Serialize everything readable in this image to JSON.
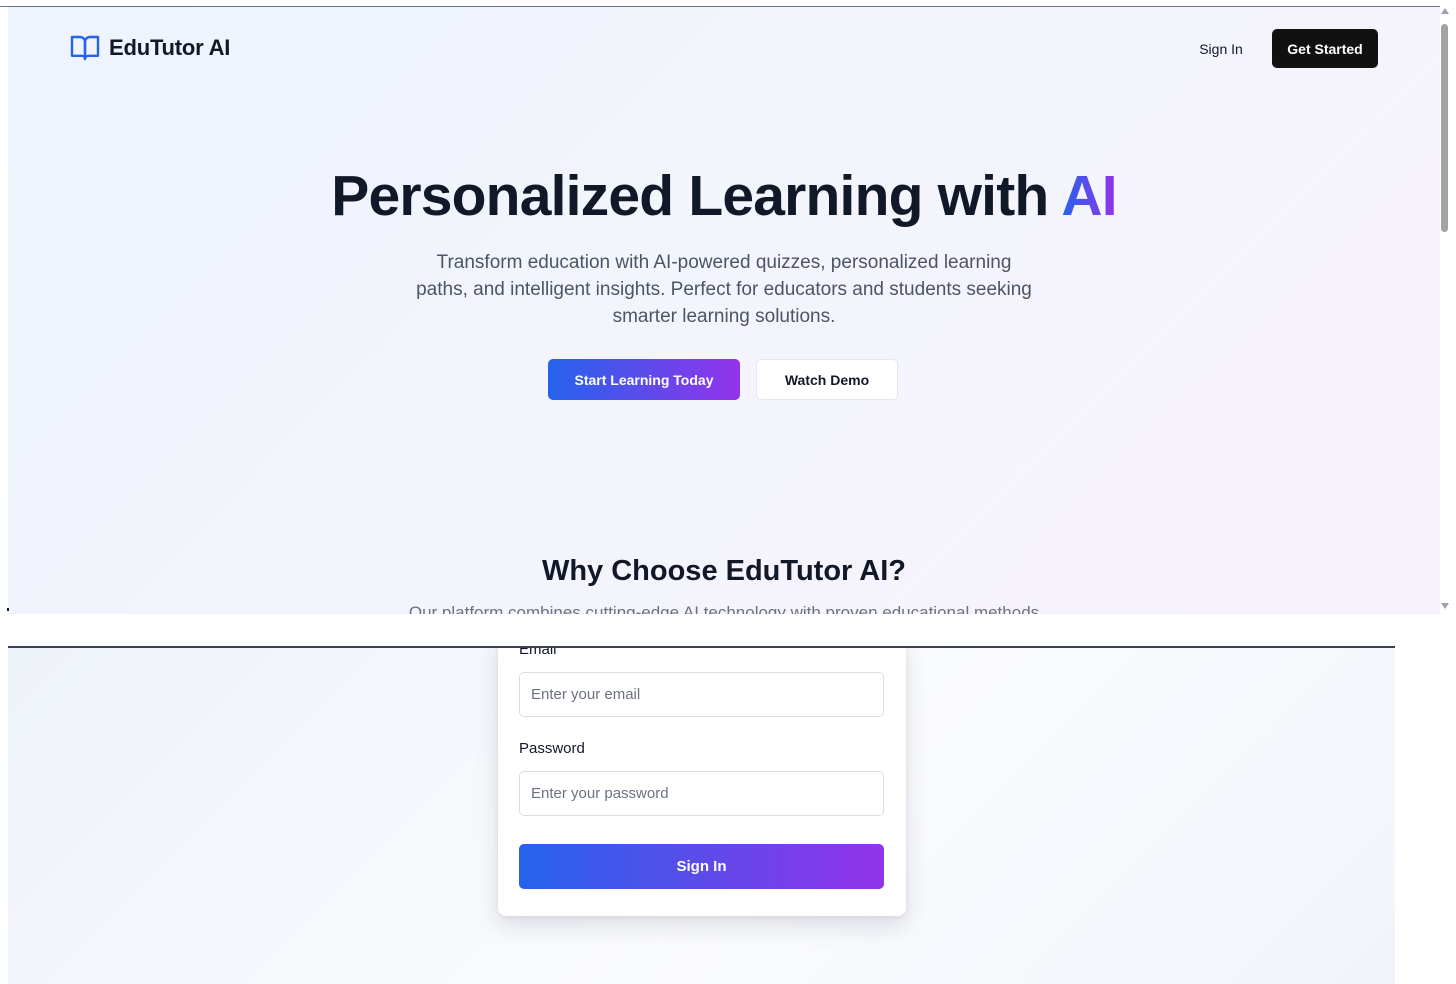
{
  "landing": {
    "brand": {
      "icon": "book-open-icon",
      "name": "EduTutor AI"
    },
    "nav": {
      "sign_in": "Sign In",
      "get_started": "Get Started"
    },
    "hero": {
      "title_main": "Personalized Learning with ",
      "title_accent": "AI",
      "description": "Transform education with AI-powered quizzes, personalized learning paths, and intelligent insights. Perfect for educators and students seeking smarter learning solutions.",
      "primary_cta": "Start Learning Today",
      "secondary_cta": "Watch Demo"
    },
    "features": {
      "title": "Why Choose EduTutor AI?",
      "subtitle": "Our platform combines cutting-edge AI technology with proven educational methods"
    }
  },
  "login": {
    "email_label": "Email",
    "email_placeholder": "Enter your email",
    "password_label": "Password",
    "password_placeholder": "Enter your password",
    "submit": "Sign In"
  },
  "colors": {
    "accent_blue": "#2563eb",
    "accent_purple": "#9333ea",
    "dark_button": "#111111",
    "text_primary": "#111827",
    "text_muted": "#4b5563"
  }
}
